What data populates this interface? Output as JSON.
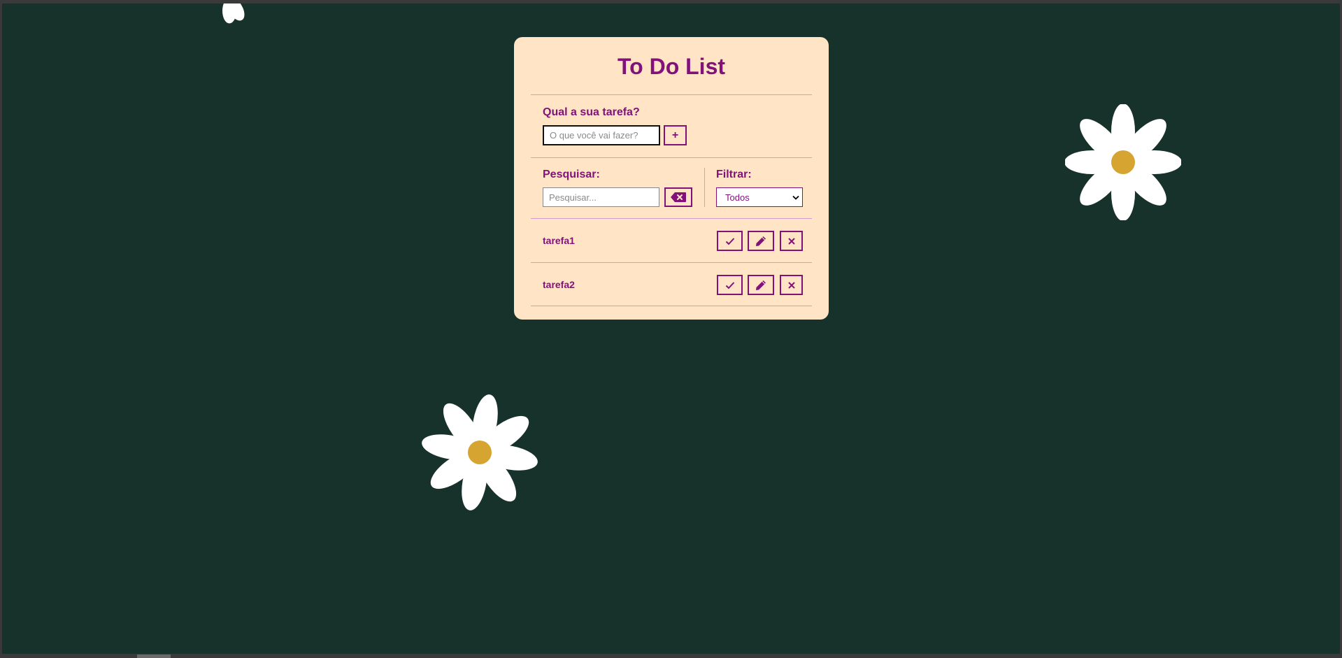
{
  "app": {
    "title": "To Do List"
  },
  "add_form": {
    "label": "Qual a sua tarefa?",
    "input_placeholder": "O que você vai fazer?",
    "input_value": "",
    "add_button_label": "+"
  },
  "search": {
    "label": "Pesquisar:",
    "placeholder": "Pesquisar...",
    "value": "",
    "clear_icon": "erase-backspace-icon"
  },
  "filter": {
    "label": "Filtrar:",
    "selected": "Todos"
  },
  "tasks": [
    {
      "title": "tarefa1",
      "actions": [
        "check-icon",
        "pencil-icon",
        "x-icon"
      ]
    },
    {
      "title": "tarefa2",
      "actions": [
        "check-icon",
        "pencil-icon",
        "x-icon"
      ]
    }
  ],
  "colors": {
    "background": "#17312b",
    "card": "#ffe4c6",
    "accent": "#82127a",
    "divider": "#d39bcc",
    "petal": "#ffffff",
    "flower_center": "#d6a431"
  }
}
